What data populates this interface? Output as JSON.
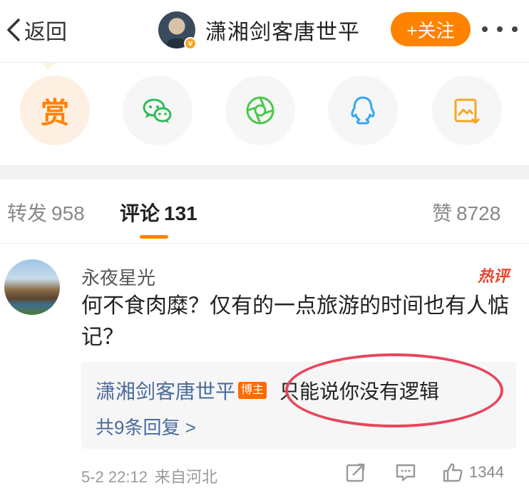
{
  "header": {
    "back_label": "返回",
    "author_name": "潇湘剑客唐世平",
    "follow_label": "+关注"
  },
  "share": {
    "reward_label": "赏",
    "items": [
      "reward-icon",
      "wechat-icon",
      "moments-icon",
      "qq-icon",
      "save-image-icon"
    ]
  },
  "tabs": {
    "repost_label": "转发",
    "repost_count": "958",
    "comment_label": "评论",
    "comment_count": "131",
    "like_label": "赞",
    "like_count": "8728"
  },
  "comment": {
    "author": "永夜星光",
    "hot_tag": "热评",
    "text": "何不食肉糜？仅有的一点旅游的时间也有人惦记？",
    "reply": {
      "author": "潇湘剑客唐世平",
      "badge": "博主",
      "text": "只能说你没有逻辑",
      "count_label": "共9条回复 >"
    },
    "date": "5-2 22:12",
    "location": "来自河北",
    "likes": "1344"
  },
  "colors": {
    "accent": "#ff8200",
    "link": "#4a6b9b",
    "annotation": "#e8455c"
  }
}
